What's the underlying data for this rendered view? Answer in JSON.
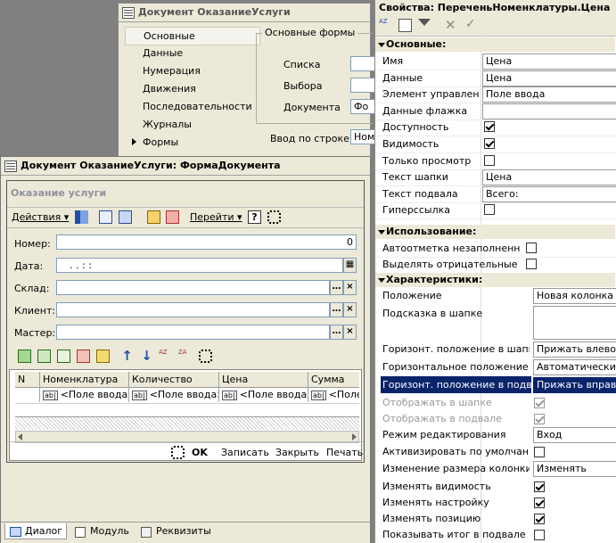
{
  "doc_window": {
    "title": "Документ ОказаниеУслуги",
    "tabs": [
      "Основные",
      "Данные",
      "Нумерация",
      "Движения",
      "Последовательности",
      "Журналы",
      "Формы"
    ],
    "group_title": "Основные формы",
    "form_labels": [
      "Списка",
      "Выбора",
      "Документа"
    ],
    "document_value": "Фо",
    "input_by_label": "Ввод по строке",
    "input_by_value": "Ном"
  },
  "form_window": {
    "title": "Документ ОказаниеУслуги: ФормаДокумента",
    "header": "Оказание услуги",
    "toolbar": {
      "actions": "Действия",
      "goto": "Перейти"
    },
    "fields": [
      {
        "label": "Номер:",
        "value": "0"
      },
      {
        "label": "Дата:",
        "value": ". .   : :"
      },
      {
        "label": "Склад:",
        "value": ""
      },
      {
        "label": "Клиент:",
        "value": ""
      },
      {
        "label": "Мастер:",
        "value": ""
      }
    ],
    "grid": {
      "columns": [
        "N",
        "Номенклатура",
        "Количество",
        "Цена",
        "Сумма"
      ],
      "row": [
        "<Поле ввода>",
        "<Поле ввода>",
        "<Поле ввода>",
        "<Поле"
      ],
      "cell_prefix": "ab|"
    },
    "buttons": {
      "ok": "OK",
      "write": "Записать",
      "close": "Закрыть",
      "print": "Печать"
    }
  },
  "bottom_tabs": [
    "Диалог",
    "Модуль",
    "Реквизиты"
  ],
  "properties": {
    "title": "Свойства: ПереченьНоменклатуры.Цена",
    "sections": {
      "main": "Основные:",
      "usage": "Использование:",
      "chars": "Характеристики:"
    },
    "main_rows": [
      {
        "name": "Имя",
        "value": "Цена"
      },
      {
        "name": "Данные",
        "value": "Цена"
      },
      {
        "name": "Элемент управления",
        "value": "Поле ввода"
      },
      {
        "name": "Данные флажка",
        "value": ""
      },
      {
        "name": "Доступность",
        "checked": true
      },
      {
        "name": "Видимость",
        "checked": true
      },
      {
        "name": "Только просмотр",
        "checked": false
      },
      {
        "name": "Текст шапки",
        "value": "Цена"
      },
      {
        "name": "Текст подвала",
        "value": "Всего:"
      },
      {
        "name": "Гиперссылка",
        "checked": false
      }
    ],
    "usage_rows": [
      {
        "name": "Автоотметка незаполненного",
        "checked": false
      },
      {
        "name": "Выделять отрицательные",
        "checked": false
      }
    ],
    "chars_rows": [
      {
        "name": "Положение",
        "value": "Новая колонка"
      },
      {
        "name": "Подсказка в шапке",
        "value": ""
      },
      {
        "name": "Горизонт. положение в шапке",
        "value": "Прижать влево"
      },
      {
        "name": "Горизонтальное положение",
        "value": "Автоматически"
      },
      {
        "name": "Горизонт. положение в подвале",
        "value": "Прижать вправо"
      },
      {
        "name": "Отображать в шапке",
        "checked": true
      },
      {
        "name": "Отображать в подвале",
        "checked": true
      },
      {
        "name": "Режим редактирования",
        "value": "Вход"
      },
      {
        "name": "Активизировать по умолчанию",
        "checked": false
      },
      {
        "name": "Изменение размера колонки",
        "value": "Изменять"
      },
      {
        "name": "Изменять видимость",
        "checked": true
      },
      {
        "name": "Изменять настройку",
        "checked": true
      },
      {
        "name": "Изменять позицию",
        "checked": true
      },
      {
        "name": "Показывать итог в подвале",
        "checked": false
      }
    ]
  }
}
